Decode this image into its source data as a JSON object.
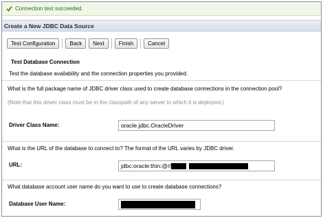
{
  "status": {
    "message": "Connection test succeeded.",
    "icon": "check-icon",
    "color": "#2f6b1e"
  },
  "window": {
    "title": "Create a New JDBC Data Source"
  },
  "toolbar": {
    "test_configuration": "Test Configuration",
    "back": "Back",
    "next": "Next",
    "finish": "Finish",
    "cancel": "Cancel"
  },
  "section": {
    "title": "Test Database Connection",
    "description": "Test the database availability and the connection properties you provided."
  },
  "driver": {
    "question": "What is the full package name of JDBC driver class used to create database connections in the connection pool?",
    "note": "(Note that this driver class must be in the classpath of any server to which it is deployed.)",
    "label": "Driver Class Name:",
    "value": "oracle.jdbc.OracleDriver"
  },
  "url": {
    "question": "What is the URL of the database to connect to? The format of the URL varies by JDBC driver.",
    "label": "URL:",
    "value": "jdbc:oracle:thin:@//"
  },
  "user": {
    "question": "What database account user name do you want to use to create database connections?",
    "label": "Database User Name:"
  }
}
